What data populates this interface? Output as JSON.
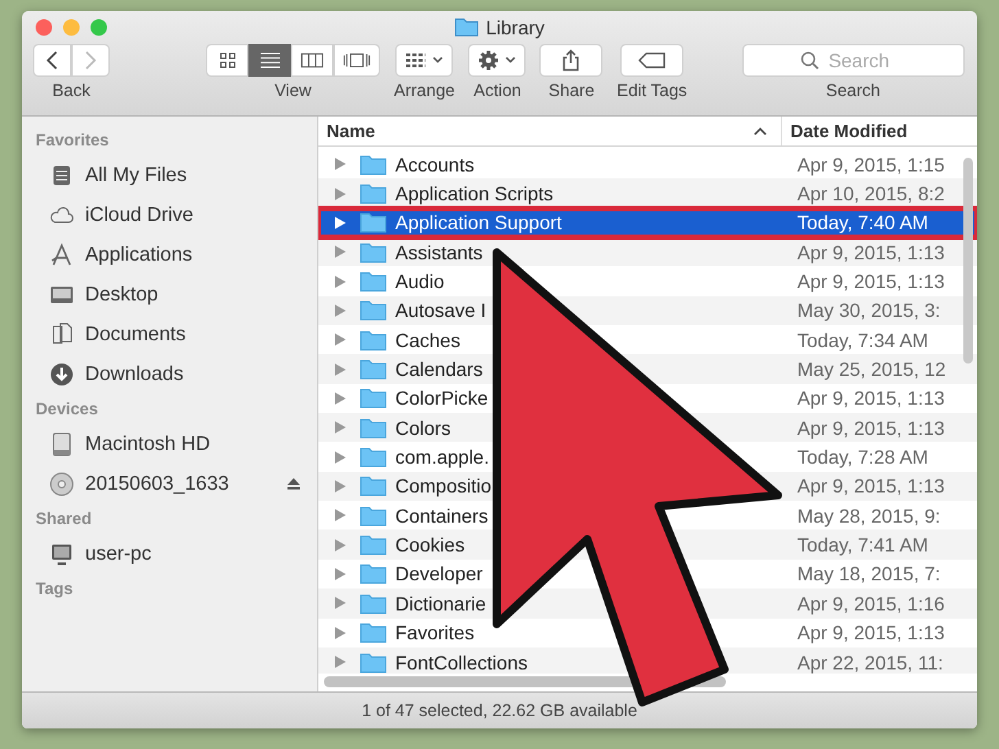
{
  "window": {
    "title": "Library"
  },
  "toolbar": {
    "back": {
      "label": "Back"
    },
    "view": {
      "label": "View",
      "modes": [
        {
          "kind": "icons",
          "selected": false
        },
        {
          "kind": "list",
          "selected": true
        },
        {
          "kind": "columns",
          "selected": false
        },
        {
          "kind": "cover",
          "selected": false
        }
      ]
    },
    "arrange": {
      "label": "Arrange"
    },
    "action": {
      "label": "Action"
    },
    "share": {
      "label": "Share"
    },
    "edit_tags": {
      "label": "Edit Tags"
    },
    "search": {
      "placeholder": "Search",
      "label": "Search"
    }
  },
  "sidebar": {
    "sections": [
      {
        "title": "Favorites",
        "items": [
          {
            "label": "All My Files",
            "kind": "files"
          },
          {
            "label": "iCloud Drive",
            "kind": "cloud"
          },
          {
            "label": "Applications",
            "kind": "apps"
          },
          {
            "label": "Desktop",
            "kind": "desktop"
          },
          {
            "label": "Documents",
            "kind": "documents"
          },
          {
            "label": "Downloads",
            "kind": "downloads"
          }
        ]
      },
      {
        "title": "Devices",
        "items": [
          {
            "label": "Macintosh HD",
            "kind": "disk"
          },
          {
            "label": "20150603_1633",
            "kind": "disc",
            "ejectable": true
          }
        ]
      },
      {
        "title": "Shared",
        "items": [
          {
            "label": "user-pc",
            "kind": "computer"
          }
        ]
      },
      {
        "title": "Tags"
      }
    ]
  },
  "table": {
    "columns": [
      {
        "label": "Name",
        "sorted": true
      },
      {
        "label": "Date Modified",
        "sorted": false
      }
    ],
    "rows": [
      {
        "name": "Accounts",
        "date": "Apr 9, 2015, 1:15",
        "selected": false
      },
      {
        "name": "Application Scripts",
        "date": "Apr 10, 2015, 8:2",
        "selected": false
      },
      {
        "name": "Application Support",
        "date": "Today, 7:40 AM",
        "selected": true
      },
      {
        "name": "Assistants",
        "date": "Apr 9, 2015, 1:13",
        "selected": false
      },
      {
        "name": "Audio",
        "date": "Apr 9, 2015, 1:13",
        "selected": false
      },
      {
        "name": "Autosave I",
        "date": "May 30, 2015, 3:",
        "selected": false
      },
      {
        "name": "Caches",
        "date": "Today, 7:34 AM",
        "selected": false
      },
      {
        "name": "Calendars",
        "date": "May 25, 2015, 12",
        "selected": false
      },
      {
        "name": "ColorPicke",
        "date": "Apr 9, 2015, 1:13",
        "selected": false
      },
      {
        "name": "Colors",
        "date": "Apr 9, 2015, 1:13",
        "selected": false
      },
      {
        "name": "com.apple.",
        "date": "Today, 7:28 AM",
        "selected": false
      },
      {
        "name": "Compositio",
        "date": "Apr 9, 2015, 1:13",
        "selected": false
      },
      {
        "name": "Containers",
        "date": "May 28, 2015, 9:",
        "selected": false
      },
      {
        "name": "Cookies",
        "date": "Today, 7:41 AM",
        "selected": false
      },
      {
        "name": "Developer",
        "date": "May 18, 2015, 7:",
        "selected": false
      },
      {
        "name": "Dictionarie",
        "date": "Apr 9, 2015, 1:16",
        "selected": false
      },
      {
        "name": "Favorites",
        "date": "Apr 9, 2015, 1:13",
        "selected": false
      },
      {
        "name": "FontCollections",
        "date": "Apr 22, 2015, 11:",
        "selected": false
      }
    ]
  },
  "status_bar": "1 of 47 selected, 22.62 GB available"
}
